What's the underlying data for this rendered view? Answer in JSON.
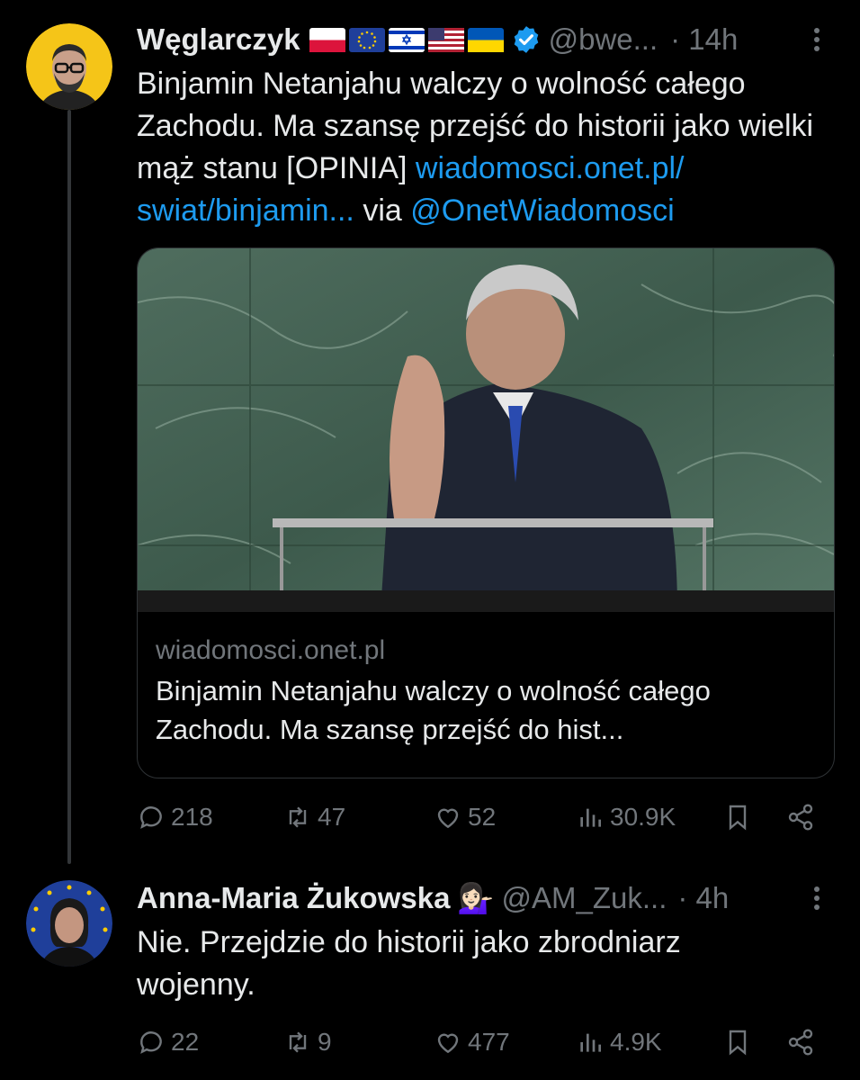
{
  "tweet1": {
    "display_name": "Węglarczyk",
    "flags": [
      "flag-poland",
      "flag-eu",
      "flag-israel",
      "flag-usa",
      "flag-ukraine"
    ],
    "verified_icon": "verified-badge-icon",
    "handle": "@bwe...",
    "time": "· 14h",
    "more_label": "⋮",
    "text_main": "Binjamin Netanjahu walczy o wolność całego Zachodu. Ma szansę przejść do historii jako wielki mąż stanu [OPINIA] ",
    "link1": "wiadomosci.onet.pl/ swiat/binjamin...",
    "via": " via ",
    "mention": "@OnetWiadomosci",
    "card": {
      "domain": "wiadomosci.onet.pl",
      "title": "Binjamin Netanjahu walczy o wolność całego Zachodu. Ma szansę przejść do hist..."
    },
    "actions": {
      "replies": "218",
      "reposts": "47",
      "likes": "52",
      "views": "30.9K"
    }
  },
  "tweet2": {
    "display_name": "Anna-Maria Żukowska",
    "emoji": "💁🏻‍♀️",
    "handle": "@AM_Zuk...",
    "time": "· 4h",
    "more_label": "⋮",
    "text": "Nie. Przejdzie do historii jako zbrodniarz wojenny.",
    "actions": {
      "replies": "22",
      "reposts": "9",
      "likes": "477",
      "views": "4.9K"
    }
  },
  "colors": {
    "background": "#000000",
    "text": "#e7e9ea",
    "muted": "#71767b",
    "link": "#1d9bf0",
    "border": "#2f3336",
    "avatar1_bg": "#f5c518",
    "avatar2_bg": "#1f3f9a"
  }
}
